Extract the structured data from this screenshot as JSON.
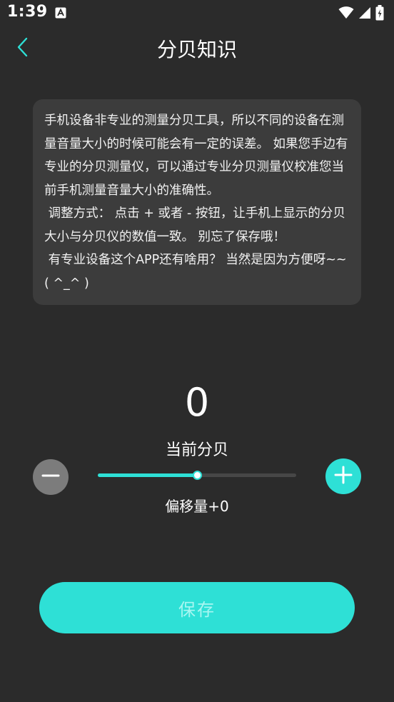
{
  "status_bar": {
    "time": "1:39",
    "icons": [
      "notification-a-icon",
      "wifi-icon",
      "signal-icon",
      "battery-icon"
    ]
  },
  "header": {
    "title": "分贝知识",
    "back_icon": "chevron-left-icon"
  },
  "info": {
    "text": "手机设备非专业的测量分贝工具，所以不同的设备在测量音量大小的时候可能会有一定的误差。 如果您手边有专业的分贝测量仪，可以通过专业分贝测量仪校准您当前手机测量音量大小的准确性。\n 调整方式： 点击 + 或者 - 按钮，让手机上显示的分贝大小与分贝仪的数值一致。 别忘了保存哦！\n 有专业设备这个APP还有啥用？ 当然是因为方便呀~~( ^_^ )"
  },
  "reading": {
    "value": "0",
    "label": "当前分贝"
  },
  "calibration": {
    "slider_fraction": 0.5,
    "offset_label": "偏移量+0",
    "minus_icon": "minus-icon",
    "plus_icon": "plus-icon"
  },
  "save": {
    "label": "保存"
  },
  "colors": {
    "background": "#2b2b2b",
    "card": "#3c3c3c",
    "accent": "#2ee0d6",
    "minus_button": "#7c7c7c",
    "save_text": "#a8f6f1"
  }
}
